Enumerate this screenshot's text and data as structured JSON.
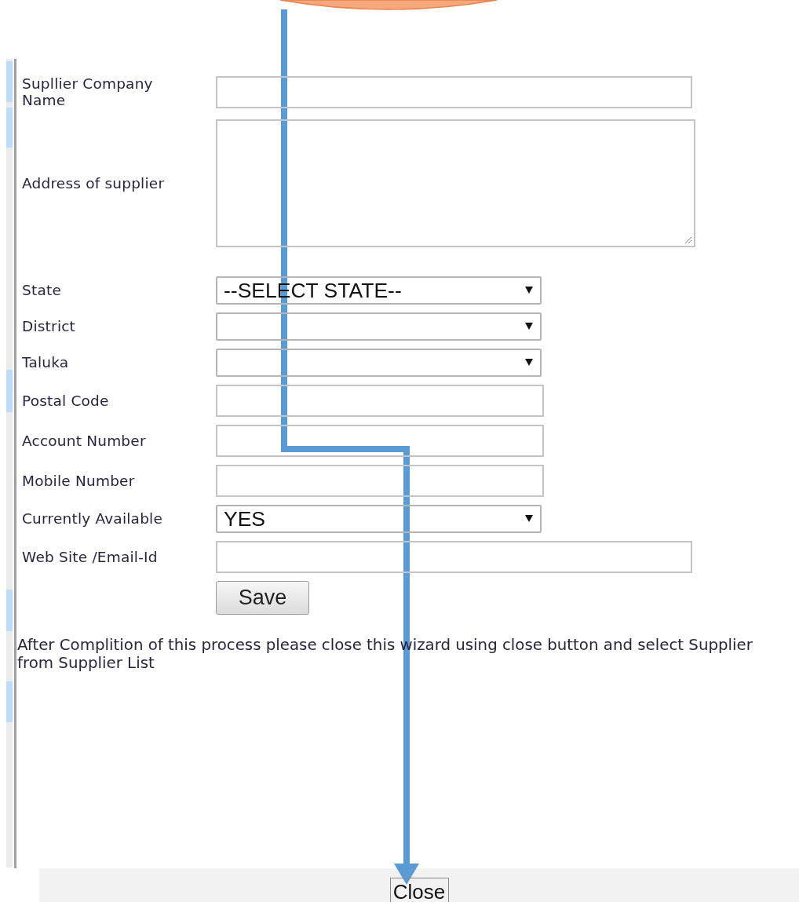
{
  "fields": [
    {
      "label": "Supllier Company Name",
      "kind": "wide-text"
    },
    {
      "label": "Address of supplier",
      "kind": "textarea"
    },
    {
      "label": "State",
      "kind": "select",
      "value": "--SELECT STATE--"
    },
    {
      "label": "District",
      "kind": "select"
    },
    {
      "label": "Taluka",
      "kind": "select"
    },
    {
      "label": "Postal Code",
      "kind": "text"
    },
    {
      "label": "Account Number",
      "kind": "text"
    },
    {
      "label": "Mobile Number",
      "kind": "text"
    },
    {
      "label": "Currently Available",
      "kind": "select",
      "value": "YES"
    },
    {
      "label": "Web Site /Email-Id",
      "kind": "wide-text"
    }
  ],
  "save_button": "Save",
  "note": "After Complition of this process please close this wizard using close button and select Supplier from Supplier List",
  "close_button": "Close"
}
